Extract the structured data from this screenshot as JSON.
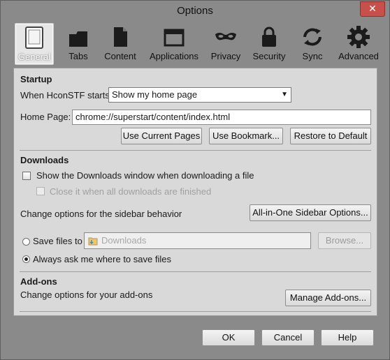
{
  "window": {
    "title": "Options",
    "close_glyph": "✕"
  },
  "toolbar": {
    "items": [
      {
        "label": "General",
        "icon": "general-icon",
        "selected": true
      },
      {
        "label": "Tabs",
        "icon": "tabs-icon"
      },
      {
        "label": "Content",
        "icon": "content-icon"
      },
      {
        "label": "Applications",
        "icon": "applications-icon"
      },
      {
        "label": "Privacy",
        "icon": "privacy-icon"
      },
      {
        "label": "Security",
        "icon": "security-icon"
      },
      {
        "label": "Sync",
        "icon": "sync-icon"
      },
      {
        "label": "Advanced",
        "icon": "advanced-icon"
      }
    ]
  },
  "startup": {
    "title": "Startup",
    "when_label": "When HconSTF starts:",
    "when_value": "Show my home page",
    "home_label": "Home Page:",
    "home_value": "chrome://superstart/content/index.html",
    "use_current": "Use Current Pages",
    "use_bookmark": "Use Bookmark...",
    "restore_default": "Restore to Default"
  },
  "downloads": {
    "title": "Downloads",
    "show_window": "Show the Downloads window when downloading a file",
    "close_when_done": "Close it when all downloads are finished",
    "sidebar_label": "Change options for the sidebar behavior",
    "sidebar_button": "All-in-One Sidebar Options...",
    "save_files_label": "Save files to",
    "save_folder": "Downloads",
    "browse": "Browse...",
    "always_ask": "Always ask me where to save files"
  },
  "addons": {
    "title": "Add-ons",
    "label": "Change options for your add-ons",
    "manage": "Manage Add-ons..."
  },
  "dialog": {
    "ok": "OK",
    "cancel": "Cancel",
    "help": "Help"
  }
}
